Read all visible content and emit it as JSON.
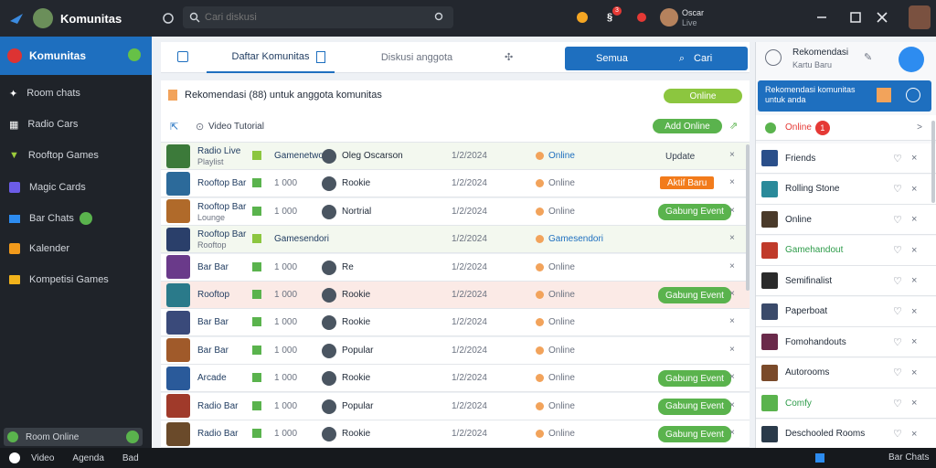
{
  "app": {
    "title": "Komunitas",
    "search_placeholder": "Cari diskusi"
  },
  "topbar": {
    "notif1": "3",
    "user_line1": "Oscar",
    "user_line2": "Live"
  },
  "sidebar": {
    "header": "Komunitas",
    "items": [
      {
        "label": "Room chats",
        "icon": "bolt-icon"
      },
      {
        "label": "Radio Cars",
        "icon": "building-icon"
      },
      {
        "label": "Rooftop Games",
        "icon": "triangle-icon"
      },
      {
        "label": "Magic Cards",
        "icon": "cube-icon"
      },
      {
        "label": "Bar Chats",
        "icon": "card-icon"
      },
      {
        "label": "Kalender",
        "icon": "calendar-icon"
      },
      {
        "label": "Kompetisi Games",
        "icon": "folder-icon"
      }
    ],
    "footer": "Room Online"
  },
  "bottombar": {
    "items": [
      "Video",
      "Agenda",
      "Bad"
    ],
    "right": "Bar Chats"
  },
  "tabs": {
    "tab1": "Daftar Komunitas",
    "tab3": "Diskusi anggota",
    "search_btn": "Cari",
    "filter": "Semua"
  },
  "panel": {
    "title": "Rekomendasi (88) untuk anggota komunitas",
    "badge": "Online",
    "view_label": "Video Tutorial",
    "add_btn": "Add Online"
  },
  "table": {
    "rows": [
      {
        "title": "Radio Live",
        "sub": "Playlist",
        "code": "Gamenetwork",
        "user": "Oleg Oscarson",
        "date": "1/2/2024",
        "status": "Online",
        "tag": "Update",
        "highlight": "header"
      },
      {
        "title": "Rooftop Bar",
        "sub": "",
        "code": "1 000",
        "user": "Rookie",
        "date": "1/2/2024",
        "status": "Online",
        "tag": "Aktif Baru",
        "tagtype": "orange"
      },
      {
        "title": "Rooftop Bar",
        "sub": "Lounge",
        "code": "1 000",
        "user": "Nortrial",
        "date": "1/2/2024",
        "status": "Online",
        "tag": "Gabung Event",
        "tagtype": "green"
      },
      {
        "title": "Rooftop Bar",
        "sub": "Rooftop",
        "code": "Gamesendori",
        "user": "",
        "date": "1/2/2024",
        "status": "Gamesendori",
        "tag": "",
        "highlight": "header"
      },
      {
        "title": "Bar Bar",
        "sub": "",
        "code": "1 000",
        "user": "Re",
        "date": "1/2/2024",
        "status": "Online",
        "tag": ""
      },
      {
        "title": "Rooftop",
        "sub": "",
        "code": "1 000",
        "user": "Rookie",
        "date": "1/2/2024",
        "status": "Online",
        "tag": "Gabung Event",
        "tagtype": "green",
        "highlight": "pink"
      },
      {
        "title": "Bar Bar",
        "sub": "",
        "code": "1 000",
        "user": "Rookie",
        "date": "1/2/2024",
        "status": "Online",
        "tag": ""
      },
      {
        "title": "Bar Bar",
        "sub": "",
        "code": "1 000",
        "user": "Popular",
        "date": "1/2/2024",
        "status": "Online",
        "tag": ""
      },
      {
        "title": "Arcade",
        "sub": "",
        "code": "1 000",
        "user": "Rookie",
        "date": "1/2/2024",
        "status": "Online",
        "tag": "Gabung Event",
        "tagtype": "green"
      },
      {
        "title": "Radio Bar",
        "sub": "",
        "code": "1 000",
        "user": "Popular",
        "date": "1/2/2024",
        "status": "Online",
        "tag": "Gabung Event",
        "tagtype": "green"
      },
      {
        "title": "Radio Bar",
        "sub": "",
        "code": "1 000",
        "user": "Rookie",
        "date": "1/2/2024",
        "status": "Online",
        "tag": "Gabung Event",
        "tagtype": "green"
      }
    ]
  },
  "right": {
    "user_line1": "Rekomendasi",
    "user_line2": "Kartu Baru",
    "banner": "Rekomendasi komunitas untuk anda",
    "online_label": "Online",
    "online_count": "1",
    "items": [
      "Friends",
      "Rolling Stone",
      "Online",
      "Gamehandout",
      "Semifinalist",
      "Paperboat",
      "Fomohandouts",
      "Autorooms",
      "Comfy",
      "Deschooled Rooms"
    ]
  },
  "colors": {
    "accent": "#1e6fbf",
    "green": "#5ab34d",
    "orange": "#f27b1b"
  }
}
